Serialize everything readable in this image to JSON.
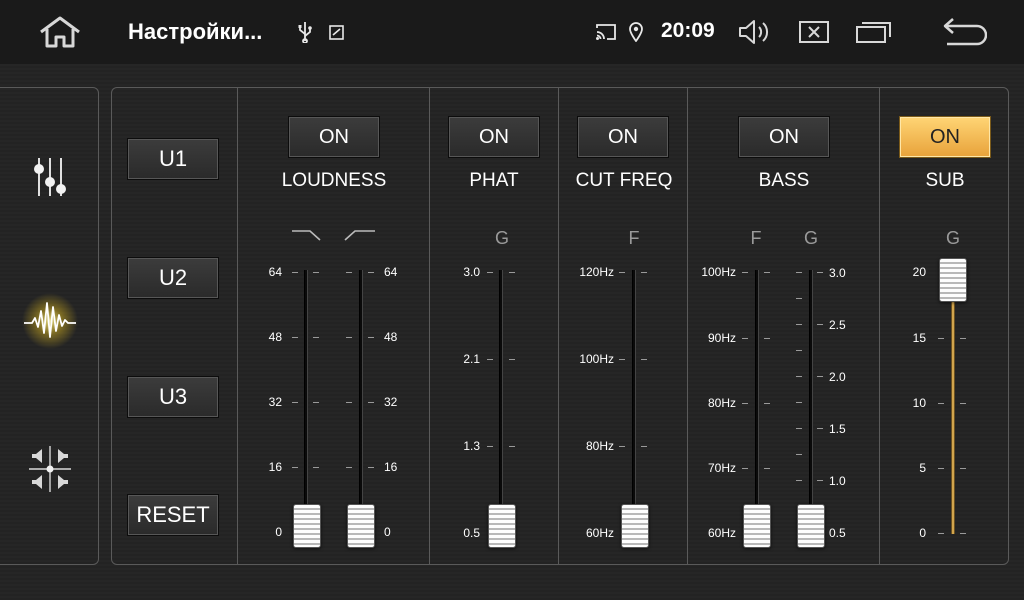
{
  "statusbar": {
    "title": "Настройки...",
    "time": "20:09",
    "icons": [
      "home-icon",
      "usb-icon",
      "screenshot-icon",
      "cast-icon",
      "location-icon",
      "volume-icon",
      "close-box-icon",
      "recent-apps-icon",
      "back-icon"
    ]
  },
  "sidebar": {
    "items": [
      {
        "name": "equalizer-sliders-icon",
        "active": false
      },
      {
        "name": "waveform-icon",
        "active": true
      },
      {
        "name": "speaker-balance-icon",
        "active": false
      }
    ]
  },
  "presets": {
    "u1": "U1",
    "u2": "U2",
    "u3": "U3",
    "reset": "RESET"
  },
  "sections": {
    "loudness": {
      "button": "ON",
      "label": "LOUDNESS",
      "active": false,
      "left_scale": [
        "64",
        "48",
        "32",
        "16",
        "0"
      ],
      "right_scale": [
        "64",
        "48",
        "32",
        "16",
        "0"
      ],
      "left_value": 0,
      "right_value": 0
    },
    "phat": {
      "button": "ON",
      "label": "PHAT",
      "active": false,
      "letter": "G",
      "scale": [
        "3.0",
        "2.1",
        "1.3",
        "0.5"
      ],
      "value": "0.5"
    },
    "cutfreq": {
      "button": "ON",
      "label": "CUT FREQ",
      "active": false,
      "letter": "F",
      "scale": [
        "120Hz",
        "100Hz",
        "80Hz",
        "60Hz"
      ],
      "value": "60Hz"
    },
    "bass": {
      "button": "ON",
      "label": "BASS",
      "active": false,
      "letter_f": "F",
      "letter_g": "G",
      "f_scale": [
        "100Hz",
        "90Hz",
        "80Hz",
        "70Hz",
        "60Hz"
      ],
      "g_scale": [
        "3.0",
        "2.5",
        "2.0",
        "1.5",
        "1.0",
        "0.5"
      ],
      "f_value": "60Hz",
      "g_value": "0.5"
    },
    "sub": {
      "button": "ON",
      "label": "SUB",
      "active": true,
      "letter": "G",
      "scale": [
        "20",
        "15",
        "10",
        "5",
        "0"
      ],
      "value": 20
    }
  },
  "colors": {
    "active_button": "#f5b84a",
    "slider_fill": "#d9a84e"
  }
}
